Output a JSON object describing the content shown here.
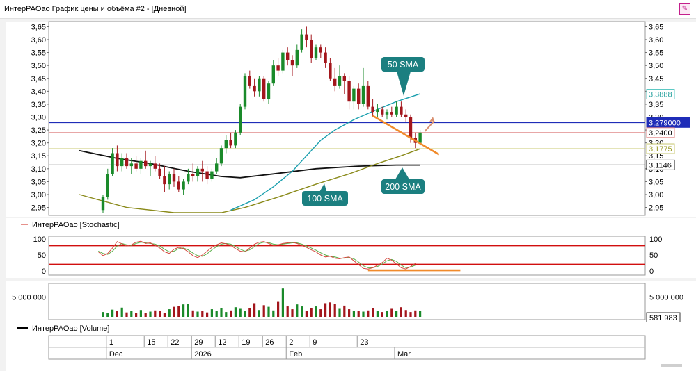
{
  "window": {
    "title": "ИнтерРАОао График цены и объёма #2 - [Дневной]",
    "pin_icon": "pin-icon"
  },
  "colors": {
    "up": "#1a8a2a",
    "down": "#a3161c",
    "sma50": "#1a9fae",
    "sma100": "#8a8a1a",
    "sma200": "#111111",
    "level_blue": "#1f2db8",
    "stoch_k": "#d4483e",
    "stoch_d": "#5ab04a",
    "stoch_band": "#d10f0f",
    "annotation": "#f08a2a",
    "callout": "#1b7f80"
  },
  "chart_data": [
    {
      "type": "candlestick",
      "name": "price",
      "ylim": [
        2.93,
        3.67
      ],
      "yticks": [
        "3,65",
        "3,60",
        "3,55",
        "3,50",
        "3,45",
        "3,40",
        "3,35",
        "3,30",
        "3,25",
        "3,20",
        "3,15",
        "3,10",
        "3,05",
        "3,00",
        "2,95"
      ],
      "ytick_values": [
        3.65,
        3.6,
        3.55,
        3.5,
        3.45,
        3.4,
        3.35,
        3.3,
        3.25,
        3.2,
        3.15,
        3.1,
        3.05,
        3.0,
        2.95
      ],
      "candles": [
        {
          "o": 2.94,
          "h": 3.0,
          "l": 2.93,
          "c": 2.99
        },
        {
          "o": 2.99,
          "h": 3.1,
          "l": 2.98,
          "c": 3.08
        },
        {
          "o": 3.08,
          "h": 3.18,
          "l": 3.07,
          "c": 3.16
        },
        {
          "o": 3.16,
          "h": 3.19,
          "l": 3.09,
          "c": 3.11
        },
        {
          "o": 3.11,
          "h": 3.16,
          "l": 3.09,
          "c": 3.14
        },
        {
          "o": 3.14,
          "h": 3.16,
          "l": 3.1,
          "c": 3.11
        },
        {
          "o": 3.11,
          "h": 3.14,
          "l": 3.08,
          "c": 3.12
        },
        {
          "o": 3.12,
          "h": 3.15,
          "l": 3.09,
          "c": 3.1
        },
        {
          "o": 3.1,
          "h": 3.14,
          "l": 3.08,
          "c": 3.13
        },
        {
          "o": 3.13,
          "h": 3.17,
          "l": 3.1,
          "c": 3.11
        },
        {
          "o": 3.11,
          "h": 3.13,
          "l": 3.07,
          "c": 3.12
        },
        {
          "o": 3.12,
          "h": 3.15,
          "l": 3.09,
          "c": 3.1
        },
        {
          "o": 3.1,
          "h": 3.12,
          "l": 3.06,
          "c": 3.07
        },
        {
          "o": 3.07,
          "h": 3.11,
          "l": 3.01,
          "c": 3.04
        },
        {
          "o": 3.04,
          "h": 3.09,
          "l": 3.02,
          "c": 3.08
        },
        {
          "o": 3.08,
          "h": 3.1,
          "l": 3.03,
          "c": 3.05
        },
        {
          "o": 3.05,
          "h": 3.07,
          "l": 3.01,
          "c": 3.02
        },
        {
          "o": 3.02,
          "h": 3.06,
          "l": 3.0,
          "c": 3.05
        },
        {
          "o": 3.05,
          "h": 3.1,
          "l": 3.04,
          "c": 3.08
        },
        {
          "o": 3.08,
          "h": 3.12,
          "l": 3.05,
          "c": 3.07
        },
        {
          "o": 3.07,
          "h": 3.11,
          "l": 3.05,
          "c": 3.1
        },
        {
          "o": 3.1,
          "h": 3.13,
          "l": 3.05,
          "c": 3.09
        },
        {
          "o": 3.09,
          "h": 3.11,
          "l": 3.04,
          "c": 3.06
        },
        {
          "o": 3.06,
          "h": 3.1,
          "l": 3.05,
          "c": 3.09
        },
        {
          "o": 3.09,
          "h": 3.14,
          "l": 3.08,
          "c": 3.12
        },
        {
          "o": 3.12,
          "h": 3.19,
          "l": 3.11,
          "c": 3.18
        },
        {
          "o": 3.18,
          "h": 3.23,
          "l": 3.16,
          "c": 3.21
        },
        {
          "o": 3.21,
          "h": 3.24,
          "l": 3.18,
          "c": 3.19
        },
        {
          "o": 3.19,
          "h": 3.25,
          "l": 3.18,
          "c": 3.24
        },
        {
          "o": 3.24,
          "h": 3.35,
          "l": 3.23,
          "c": 3.34
        },
        {
          "o": 3.34,
          "h": 3.47,
          "l": 3.33,
          "c": 3.46
        },
        {
          "o": 3.46,
          "h": 3.48,
          "l": 3.41,
          "c": 3.42
        },
        {
          "o": 3.42,
          "h": 3.45,
          "l": 3.38,
          "c": 3.4
        },
        {
          "o": 3.4,
          "h": 3.46,
          "l": 3.38,
          "c": 3.45
        },
        {
          "o": 3.45,
          "h": 3.46,
          "l": 3.36,
          "c": 3.37
        },
        {
          "o": 3.37,
          "h": 3.44,
          "l": 3.35,
          "c": 3.43
        },
        {
          "o": 3.43,
          "h": 3.52,
          "l": 3.42,
          "c": 3.5
        },
        {
          "o": 3.5,
          "h": 3.53,
          "l": 3.46,
          "c": 3.48
        },
        {
          "o": 3.48,
          "h": 3.56,
          "l": 3.47,
          "c": 3.55
        },
        {
          "o": 3.55,
          "h": 3.57,
          "l": 3.5,
          "c": 3.52
        },
        {
          "o": 3.52,
          "h": 3.54,
          "l": 3.46,
          "c": 3.5
        },
        {
          "o": 3.5,
          "h": 3.58,
          "l": 3.49,
          "c": 3.56
        },
        {
          "o": 3.56,
          "h": 3.64,
          "l": 3.55,
          "c": 3.62
        },
        {
          "o": 3.62,
          "h": 3.65,
          "l": 3.57,
          "c": 3.6
        },
        {
          "o": 3.6,
          "h": 3.62,
          "l": 3.51,
          "c": 3.53
        },
        {
          "o": 3.53,
          "h": 3.58,
          "l": 3.52,
          "c": 3.57
        },
        {
          "o": 3.57,
          "h": 3.58,
          "l": 3.53,
          "c": 3.55
        },
        {
          "o": 3.55,
          "h": 3.57,
          "l": 3.49,
          "c": 3.51
        },
        {
          "o": 3.51,
          "h": 3.53,
          "l": 3.44,
          "c": 3.45
        },
        {
          "o": 3.45,
          "h": 3.49,
          "l": 3.4,
          "c": 3.42
        },
        {
          "o": 3.42,
          "h": 3.5,
          "l": 3.41,
          "c": 3.46
        },
        {
          "o": 3.46,
          "h": 3.47,
          "l": 3.39,
          "c": 3.44
        },
        {
          "o": 3.44,
          "h": 3.46,
          "l": 3.33,
          "c": 3.36
        },
        {
          "o": 3.36,
          "h": 3.42,
          "l": 3.33,
          "c": 3.41
        },
        {
          "o": 3.41,
          "h": 3.43,
          "l": 3.33,
          "c": 3.35
        },
        {
          "o": 3.35,
          "h": 3.49,
          "l": 3.34,
          "c": 3.42
        },
        {
          "o": 3.42,
          "h": 3.44,
          "l": 3.33,
          "c": 3.34
        },
        {
          "o": 3.34,
          "h": 3.37,
          "l": 3.3,
          "c": 3.32
        },
        {
          "o": 3.32,
          "h": 3.35,
          "l": 3.3,
          "c": 3.33
        },
        {
          "o": 3.33,
          "h": 3.34,
          "l": 3.3,
          "c": 3.31
        },
        {
          "o": 3.31,
          "h": 3.33,
          "l": 3.29,
          "c": 3.32
        },
        {
          "o": 3.32,
          "h": 3.34,
          "l": 3.3,
          "c": 3.31
        },
        {
          "o": 3.31,
          "h": 3.36,
          "l": 3.3,
          "c": 3.34
        },
        {
          "o": 3.34,
          "h": 3.36,
          "l": 3.3,
          "c": 3.31
        },
        {
          "o": 3.31,
          "h": 3.33,
          "l": 3.28,
          "c": 3.3
        },
        {
          "o": 3.3,
          "h": 3.31,
          "l": 3.2,
          "c": 3.22
        },
        {
          "o": 3.22,
          "h": 3.24,
          "l": 3.18,
          "c": 3.2
        },
        {
          "o": 3.2,
          "h": 3.25,
          "l": 3.19,
          "c": 3.24
        }
      ],
      "sma50": {
        "name": "50 SMA",
        "points": [
          [
            27,
            2.94
          ],
          [
            32,
            2.98
          ],
          [
            36,
            3.03
          ],
          [
            40,
            3.09
          ],
          [
            43,
            3.15
          ],
          [
            46,
            3.21
          ],
          [
            49,
            3.25
          ],
          [
            53,
            3.29
          ],
          [
            58,
            3.33
          ],
          [
            62,
            3.36
          ],
          [
            67,
            3.39
          ]
        ]
      },
      "sma100": {
        "name": "100 SMA",
        "points": [
          [
            -5,
            3.0
          ],
          [
            5,
            2.95
          ],
          [
            15,
            2.93
          ],
          [
            25,
            2.93
          ],
          [
            30,
            2.95
          ],
          [
            37,
            2.99
          ],
          [
            45,
            3.04
          ],
          [
            52,
            3.08
          ],
          [
            58,
            3.12
          ],
          [
            63,
            3.15
          ],
          [
            67,
            3.177
          ]
        ]
      },
      "sma200": {
        "name": "200 SMA",
        "points": [
          [
            -5,
            3.17
          ],
          [
            3,
            3.14
          ],
          [
            10,
            3.12
          ],
          [
            18,
            3.09
          ],
          [
            25,
            3.07
          ],
          [
            29,
            3.065
          ],
          [
            36,
            3.08
          ],
          [
            45,
            3.1
          ],
          [
            54,
            3.11
          ],
          [
            62,
            3.114
          ],
          [
            67,
            3.114
          ]
        ]
      },
      "levels": [
        {
          "value": 3.3888,
          "label": "3,3888",
          "color": "#5dc9c4"
        },
        {
          "value": 3.279,
          "label": "3,279000",
          "color": "#1f2db8"
        },
        {
          "value": 3.24,
          "label": "3,2400",
          "color": "#e08a8a"
        },
        {
          "value": 3.1775,
          "label": "3,1775",
          "color": "#c8c870"
        },
        {
          "value": 3.1146,
          "label": "3,1146",
          "color": "#111111"
        }
      ],
      "annotations": [
        {
          "type": "trendline",
          "from": [
            57,
            3.305
          ],
          "to": [
            71,
            3.155
          ]
        },
        {
          "type": "arrow",
          "from": [
            68,
            3.245
          ],
          "to": [
            70,
            3.285
          ]
        }
      ],
      "callouts": [
        "50 SMA",
        "100 SMA",
        "200 SMA"
      ]
    },
    {
      "type": "line",
      "name": "stochastic",
      "title": "ИнтерРАОао [Stochastic]",
      "ylim": [
        0,
        100
      ],
      "yticks": [
        "100",
        "50",
        "0"
      ],
      "ytick_values": [
        100,
        50,
        0
      ],
      "bands": [
        80,
        20
      ],
      "series": [
        {
          "key": "k",
          "values": [
            60,
            48,
            55,
            72,
            92,
            85,
            78,
            82,
            90,
            93,
            86,
            88,
            80,
            72,
            60,
            55,
            68,
            74,
            70,
            60,
            48,
            42,
            50,
            62,
            74,
            82,
            88,
            85,
            80,
            70,
            62,
            60,
            72,
            84,
            90,
            92,
            86,
            80,
            82,
            86,
            88,
            90,
            86,
            80,
            74,
            66,
            60,
            50,
            44,
            46,
            40,
            38,
            42,
            44,
            32,
            20,
            8,
            6,
            10,
            18,
            26,
            40,
            34,
            22,
            10,
            6,
            14,
            24
          ]
        },
        {
          "key": "d",
          "values": [
            62,
            55,
            52,
            62,
            78,
            86,
            82,
            80,
            86,
            90,
            88,
            86,
            84,
            78,
            68,
            60,
            62,
            70,
            72,
            66,
            56,
            48,
            46,
            54,
            66,
            76,
            84,
            86,
            84,
            76,
            68,
            62,
            66,
            76,
            86,
            90,
            89,
            84,
            82,
            84,
            86,
            88,
            88,
            84,
            78,
            72,
            65,
            57,
            50,
            46,
            44,
            40,
            40,
            42,
            38,
            28,
            16,
            10,
            10,
            14,
            22,
            32,
            36,
            30,
            18,
            10,
            12,
            18
          ]
        }
      ],
      "annotation": {
        "type": "line",
        "value": 2
      }
    },
    {
      "type": "bar",
      "name": "volume",
      "title": "ИнтерРАОао [Volume]",
      "ylim": [
        0,
        8000000
      ],
      "yticks": [
        "5 000 000"
      ],
      "ytick_values": [
        5000000
      ],
      "last_value_label": "581 983",
      "values": [
        1200000,
        900000,
        1800000,
        1500000,
        2300000,
        1100000,
        1400000,
        1000000,
        1700000,
        900000,
        1300000,
        1600000,
        1400000,
        1000000,
        1900000,
        2500000,
        2700000,
        3100000,
        3300000,
        1600000,
        1300000,
        1400000,
        1100000,
        1900000,
        1500000,
        2100000,
        1200000,
        1600000,
        2400000,
        2000000,
        1400000,
        2200000,
        3400000,
        1700000,
        2900000,
        2500000,
        1600000,
        3900000,
        7100000,
        2600000,
        1900000,
        3100000,
        2600000,
        1400000,
        2200000,
        2600000,
        1900000,
        3400000,
        3600000,
        3300000,
        2000000,
        2800000,
        1900000,
        1500000,
        1400000,
        1300000,
        1600000,
        2200000,
        1400000,
        1200000,
        1500000,
        2000000,
        1500000,
        2400000,
        1700000,
        1200000,
        1600000,
        1400000
      ]
    }
  ],
  "time_axis": {
    "day_labels": [
      {
        "label": "1",
        "index": 2.3
      },
      {
        "label": "15",
        "index": 10.3
      },
      {
        "label": "22",
        "index": 15.3
      },
      {
        "label": "29",
        "index": 20.3
      },
      {
        "label": "12",
        "index": 25.3
      },
      {
        "label": "19",
        "index": 30.3
      },
      {
        "label": "26",
        "index": 35.3
      },
      {
        "label": "2",
        "index": 40.3
      },
      {
        "label": "9",
        "index": 45.3
      },
      {
        "label": "23",
        "index": 55.3
      }
    ],
    "month_labels": [
      {
        "label": "Dec",
        "index": 2.3
      },
      {
        "label": "2026",
        "index": 20.3
      },
      {
        "label": "Feb",
        "index": 40.3
      },
      {
        "label": "Mar",
        "index": 63.2
      }
    ]
  }
}
